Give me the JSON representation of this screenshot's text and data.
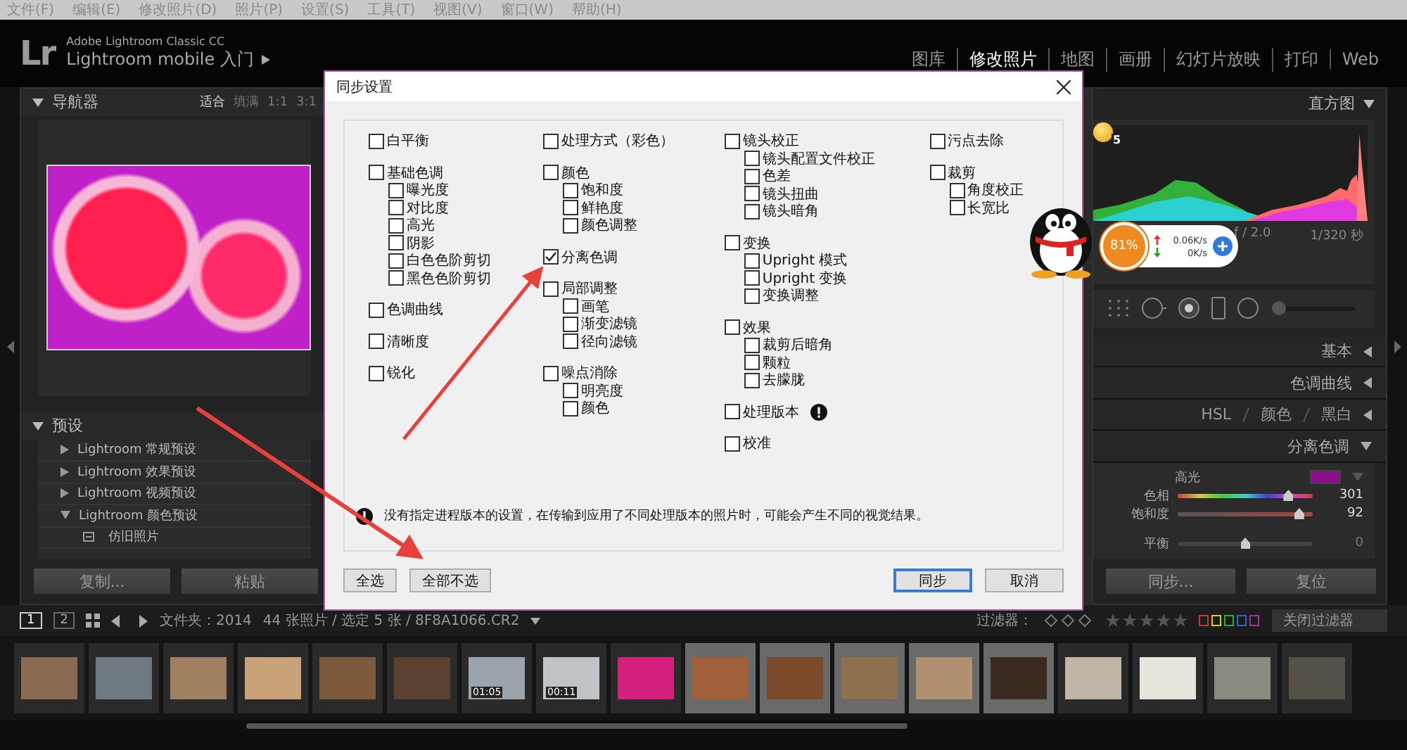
{
  "menu": [
    "文件(F)",
    "编辑(E)",
    "修改照片(D)",
    "照片(P)",
    "设置(S)",
    "工具(T)",
    "视图(V)",
    "窗口(W)",
    "帮助(H)"
  ],
  "app": {
    "logo": "Lr",
    "product": "Adobe Lightroom Classic CC",
    "identity": "Lightroom mobile 入门"
  },
  "modules": [
    {
      "label": "图库",
      "selected": false
    },
    {
      "label": "修改照片",
      "selected": true
    },
    {
      "label": "地图",
      "selected": false
    },
    {
      "label": "画册",
      "selected": false
    },
    {
      "label": "幻灯片放映",
      "selected": false
    },
    {
      "label": "打印",
      "selected": false
    },
    {
      "label": "Web",
      "selected": false
    }
  ],
  "navigator": {
    "title": "导航器",
    "zooms": [
      {
        "label": "适合",
        "selected": true
      },
      {
        "label": "填满",
        "selected": false
      },
      {
        "label": "1:1",
        "selected": false
      },
      {
        "label": "3:1",
        "selected": false
      }
    ]
  },
  "presets": {
    "title": "预设",
    "items": [
      {
        "label": "Lightroom 常规预设",
        "expanded": false
      },
      {
        "label": "Lightroom 效果预设",
        "expanded": false
      },
      {
        "label": "Lightroom 视频预设",
        "expanded": false
      },
      {
        "label": "Lightroom 颜色预设",
        "expanded": true,
        "children": [
          {
            "label": "仿旧照片"
          }
        ]
      }
    ]
  },
  "left_buttons": [
    "复制...",
    "粘贴"
  ],
  "histogram": {
    "title": "直方图",
    "aperture": "f / 2.0",
    "shutter": "1/320 秒"
  },
  "panels": [
    {
      "title": "基本",
      "expanded": false
    },
    {
      "title": "色调曲线",
      "expanded": false
    }
  ],
  "hsl_tabs": [
    "HSL",
    "颜色",
    "黑白"
  ],
  "split_toning": {
    "title": "分离色调",
    "expanded": true,
    "section": "高光",
    "sliders": [
      {
        "label": "色相",
        "reading": "301",
        "level": 0.82
      },
      {
        "label": "饱和度",
        "reading": "92",
        "level": 0.9
      },
      {
        "label": "平衡",
        "reading": "0",
        "level": 0.5
      }
    ]
  },
  "right_buttons": [
    "同步...",
    "复位"
  ],
  "toolbar": {
    "views": [
      {
        "label": "1",
        "selected": true
      },
      {
        "label": "2",
        "selected": false
      }
    ],
    "source": "文件夹：2014",
    "count": "44 张照片 / 选定 5 张 / 8F8A1066.CR2",
    "filter_label": "过滤器：",
    "filter_menu": "关闭过滤器"
  },
  "filmstrip": [
    {
      "selected": false
    },
    {
      "selected": false
    },
    {
      "selected": false
    },
    {
      "selected": false
    },
    {
      "selected": false
    },
    {
      "selected": false
    },
    {
      "selected": false,
      "duration": "01:05"
    },
    {
      "selected": false,
      "duration": "00:11"
    },
    {
      "selected": false
    },
    {
      "selected": true
    },
    {
      "selected": true
    },
    {
      "selected": true
    },
    {
      "selected": true
    },
    {
      "selected": true
    },
    {
      "selected": false
    },
    {
      "selected": false
    },
    {
      "selected": false
    },
    {
      "selected": false
    }
  ],
  "dialog": {
    "title": "同步设置",
    "columns": [
      [
        {
          "label": "白平衡",
          "checked": false
        },
        {
          "label": "基础色调",
          "checked": false,
          "children": [
            {
              "label": "曝光度",
              "checked": false
            },
            {
              "label": "对比度",
              "checked": false
            },
            {
              "label": "高光",
              "checked": false
            },
            {
              "label": "阴影",
              "checked": false
            },
            {
              "label": "白色色阶剪切",
              "checked": false
            },
            {
              "label": "黑色色阶剪切",
              "checked": false
            }
          ]
        },
        {
          "label": "色调曲线",
          "checked": false
        },
        {
          "label": "清晰度",
          "checked": false
        },
        {
          "label": "锐化",
          "checked": false
        }
      ],
      [
        {
          "label": "处理方式（彩色）",
          "checked": false
        },
        {
          "label": "颜色",
          "checked": false,
          "children": [
            {
              "label": "饱和度",
              "checked": false
            },
            {
              "label": "鲜艳度",
              "checked": false
            },
            {
              "label": "颜色调整",
              "checked": false
            }
          ]
        },
        {
          "label": "分离色调",
          "checked": true
        },
        {
          "label": "局部调整",
          "checked": false,
          "children": [
            {
              "label": "画笔",
              "checked": false
            },
            {
              "label": "渐变滤镜",
              "checked": false
            },
            {
              "label": "径向滤镜",
              "checked": false
            }
          ]
        },
        {
          "label": "噪点消除",
          "checked": false,
          "children": [
            {
              "label": "明亮度",
              "checked": false
            },
            {
              "label": "颜色",
              "checked": false
            }
          ]
        }
      ],
      [
        {
          "label": "镜头校正",
          "checked": false,
          "children": [
            {
              "label": "镜头配置文件校正",
              "checked": false
            },
            {
              "label": "色差",
              "checked": false
            },
            {
              "label": "镜头扭曲",
              "checked": false
            },
            {
              "label": "镜头暗角",
              "checked": false
            }
          ]
        },
        {
          "label": "变换",
          "checked": false,
          "children": [
            {
              "label": "Upright 模式",
              "checked": false
            },
            {
              "label": "Upright 变换",
              "checked": false
            },
            {
              "label": "变换调整",
              "checked": false
            }
          ]
        },
        {
          "label": "效果",
          "checked": false,
          "children": [
            {
              "label": "裁剪后暗角",
              "checked": false
            },
            {
              "label": "颗粒",
              "checked": false
            },
            {
              "label": "去朦胧",
              "checked": false
            }
          ]
        },
        {
          "label": "处理版本",
          "checked": false,
          "warning": true
        },
        {
          "label": "校准",
          "checked": false
        }
      ],
      [
        {
          "label": "污点去除",
          "checked": false
        },
        {
          "label": "裁剪",
          "checked": false,
          "children": [
            {
              "label": "角度校正",
              "checked": false
            },
            {
              "label": "长宽比",
              "checked": false
            }
          ]
        }
      ]
    ],
    "note": "没有指定进程版本的设置，在传输到应用了不同处理版本的照片时，可能会产生不同的视觉结果。",
    "left_buttons": [
      {
        "label": "全选",
        "default": false
      },
      {
        "label": "全部不选",
        "default": false
      }
    ],
    "right_buttons": [
      {
        "label": "同步",
        "default": true
      },
      {
        "label": "取消",
        "default": false
      }
    ]
  },
  "net_widget": {
    "percent": "81%",
    "upload": "0.06K/s",
    "download": "0K/s"
  },
  "bulb_badge": "5"
}
